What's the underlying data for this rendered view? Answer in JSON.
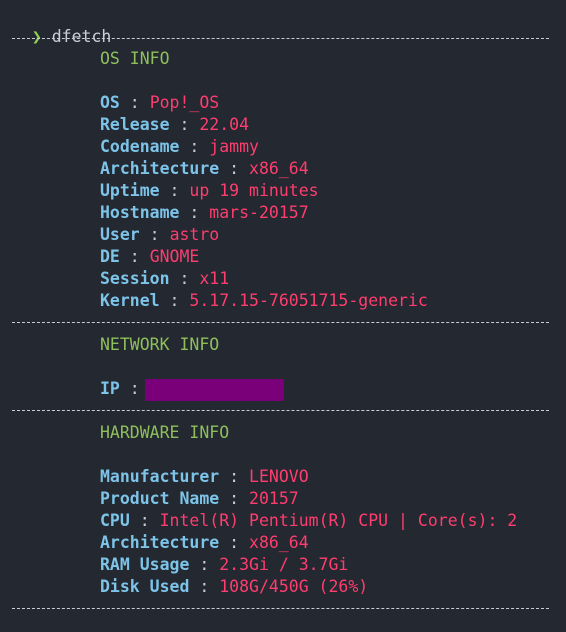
{
  "prompt": {
    "symbol": "❯",
    "command": "dfetch"
  },
  "separator": " : ",
  "sections": {
    "os": {
      "title": "OS INFO",
      "rows": [
        {
          "key": "OS",
          "value": "Pop!_OS"
        },
        {
          "key": "Release",
          "value": "22.04"
        },
        {
          "key": "Codename",
          "value": "jammy"
        },
        {
          "key": "Architecture",
          "value": "x86_64"
        },
        {
          "key": "Uptime",
          "value": "up 19 minutes"
        },
        {
          "key": "Hostname",
          "value": "mars-20157"
        },
        {
          "key": "User",
          "value": "astro"
        },
        {
          "key": "DE",
          "value": "GNOME"
        },
        {
          "key": "Session",
          "value": "x11"
        },
        {
          "key": "Kernel",
          "value": "5.17.15-76051715-generic"
        }
      ]
    },
    "network": {
      "title": "NETWORK INFO",
      "rows": [
        {
          "key": "IP",
          "value": ""
        }
      ]
    },
    "hardware": {
      "title": "HARDWARE INFO",
      "rows": [
        {
          "key": "Manufacturer",
          "value": "LENOVO"
        },
        {
          "key": "Product Name",
          "value": "20157"
        },
        {
          "key": "CPU",
          "value": "Intel(R) Pentium(R) CPU | Core(s): 2"
        },
        {
          "key": "Architecture",
          "value": "x86_64"
        },
        {
          "key": "RAM Usage",
          "value": "2.3Gi / 3.7Gi"
        },
        {
          "key": "Disk Used",
          "value": "108G/450G (26%)"
        }
      ]
    }
  },
  "colors": {
    "background": "#232831",
    "prompt": "#8fd14f",
    "section_title": "#8fbf5a",
    "key": "#7dc4e8",
    "value": "#ff3d6e",
    "redaction": "#7a007a"
  }
}
